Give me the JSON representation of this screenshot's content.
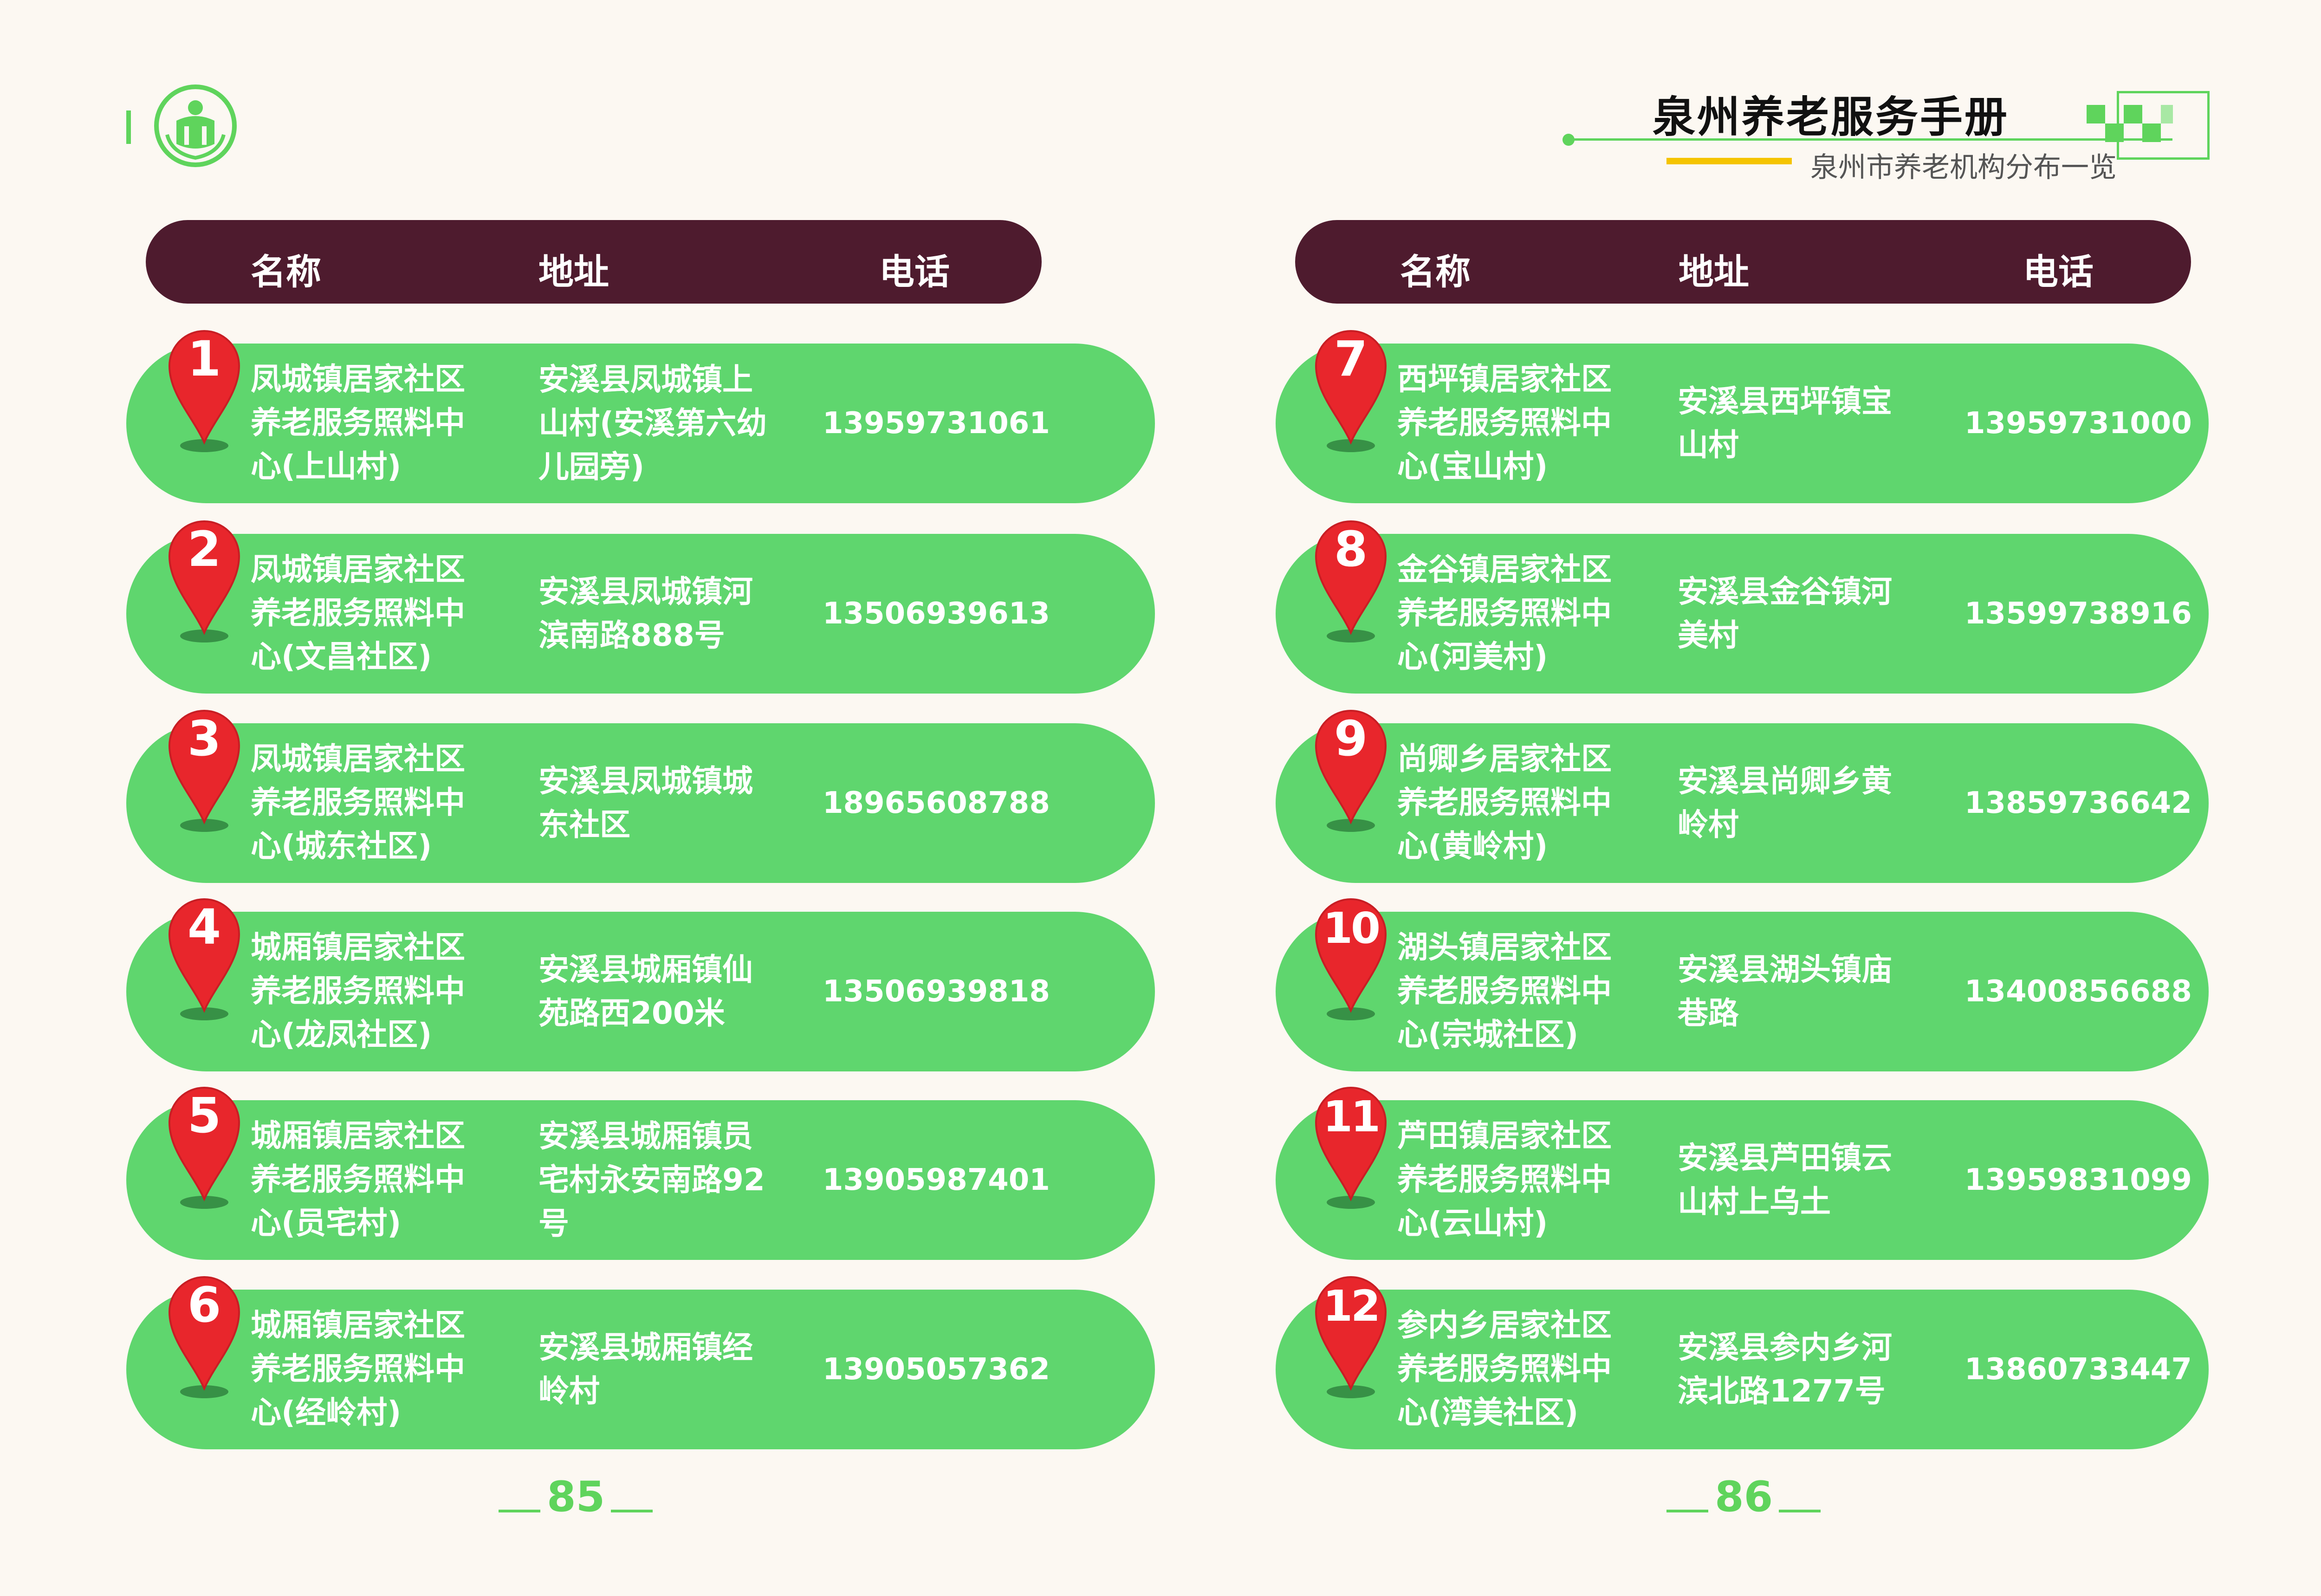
{
  "header": {
    "title": "泉州养老服务手册",
    "subtitle": "泉州市养老机构分布一览"
  },
  "columns": {
    "name": "名称",
    "address": "地址",
    "phone": "电话"
  },
  "left_rows": [
    {
      "num": "1",
      "name": [
        "凤城镇居家社区",
        "养老服务照料中",
        "心(上山村)"
      ],
      "address": [
        "安溪县凤城镇上",
        "山村(安溪第六幼",
        "儿园旁)"
      ],
      "phone": "13959731061"
    },
    {
      "num": "2",
      "name": [
        "凤城镇居家社区",
        "养老服务照料中",
        "心(文昌社区)"
      ],
      "address": [
        "安溪县凤城镇河",
        "滨南路888号"
      ],
      "phone": "13506939613"
    },
    {
      "num": "3",
      "name": [
        "凤城镇居家社区",
        "养老服务照料中",
        "心(城东社区)"
      ],
      "address": [
        "安溪县凤城镇城",
        "东社区"
      ],
      "phone": "18965608788"
    },
    {
      "num": "4",
      "name": [
        "城厢镇居家社区",
        "养老服务照料中",
        "心(龙凤社区)"
      ],
      "address": [
        "安溪县城厢镇仙",
        "苑路西200米"
      ],
      "phone": "13506939818"
    },
    {
      "num": "5",
      "name": [
        "城厢镇居家社区",
        "养老服务照料中",
        "心(员宅村)"
      ],
      "address": [
        "安溪县城厢镇员",
        "宅村永安南路92",
        "号"
      ],
      "phone": "13905987401"
    },
    {
      "num": "6",
      "name": [
        "城厢镇居家社区",
        "养老服务照料中",
        "心(经岭村)"
      ],
      "address": [
        "安溪县城厢镇经",
        "岭村"
      ],
      "phone": "13905057362"
    }
  ],
  "right_rows": [
    {
      "num": "7",
      "name": [
        "西坪镇居家社区",
        "养老服务照料中",
        "心(宝山村)"
      ],
      "address": [
        "安溪县西坪镇宝",
        "山村"
      ],
      "phone": "13959731000"
    },
    {
      "num": "8",
      "name": [
        "金谷镇居家社区",
        "养老服务照料中",
        "心(河美村)"
      ],
      "address": [
        "安溪县金谷镇河",
        "美村"
      ],
      "phone": "13599738916"
    },
    {
      "num": "9",
      "name": [
        "尚卿乡居家社区",
        "养老服务照料中",
        "心(黄岭村)"
      ],
      "address": [
        "安溪县尚卿乡黄",
        "岭村"
      ],
      "phone": "13859736642"
    },
    {
      "num": "10",
      "name": [
        "湖头镇居家社区",
        "养老服务照料中",
        "心(宗城社区)"
      ],
      "address": [
        "安溪县湖头镇庙",
        "巷路"
      ],
      "phone": "13400856688"
    },
    {
      "num": "11",
      "name": [
        "芦田镇居家社区",
        "养老服务照料中",
        "心(云山村)"
      ],
      "address": [
        "安溪县芦田镇云",
        "山村上乌土"
      ],
      "phone": "13959831099"
    },
    {
      "num": "12",
      "name": [
        "参内乡居家社区",
        "养老服务照料中",
        "心(湾美社区)"
      ],
      "address": [
        "安溪县参内乡河",
        "滨北路1277号"
      ],
      "phone": "13860733447"
    }
  ],
  "page_numbers": {
    "left": "85",
    "right": "86"
  },
  "colors": {
    "row": "#5fd66e",
    "header_bar": "#4e1b2e",
    "pin": "#e8262c",
    "accent": "#5fd45c"
  }
}
